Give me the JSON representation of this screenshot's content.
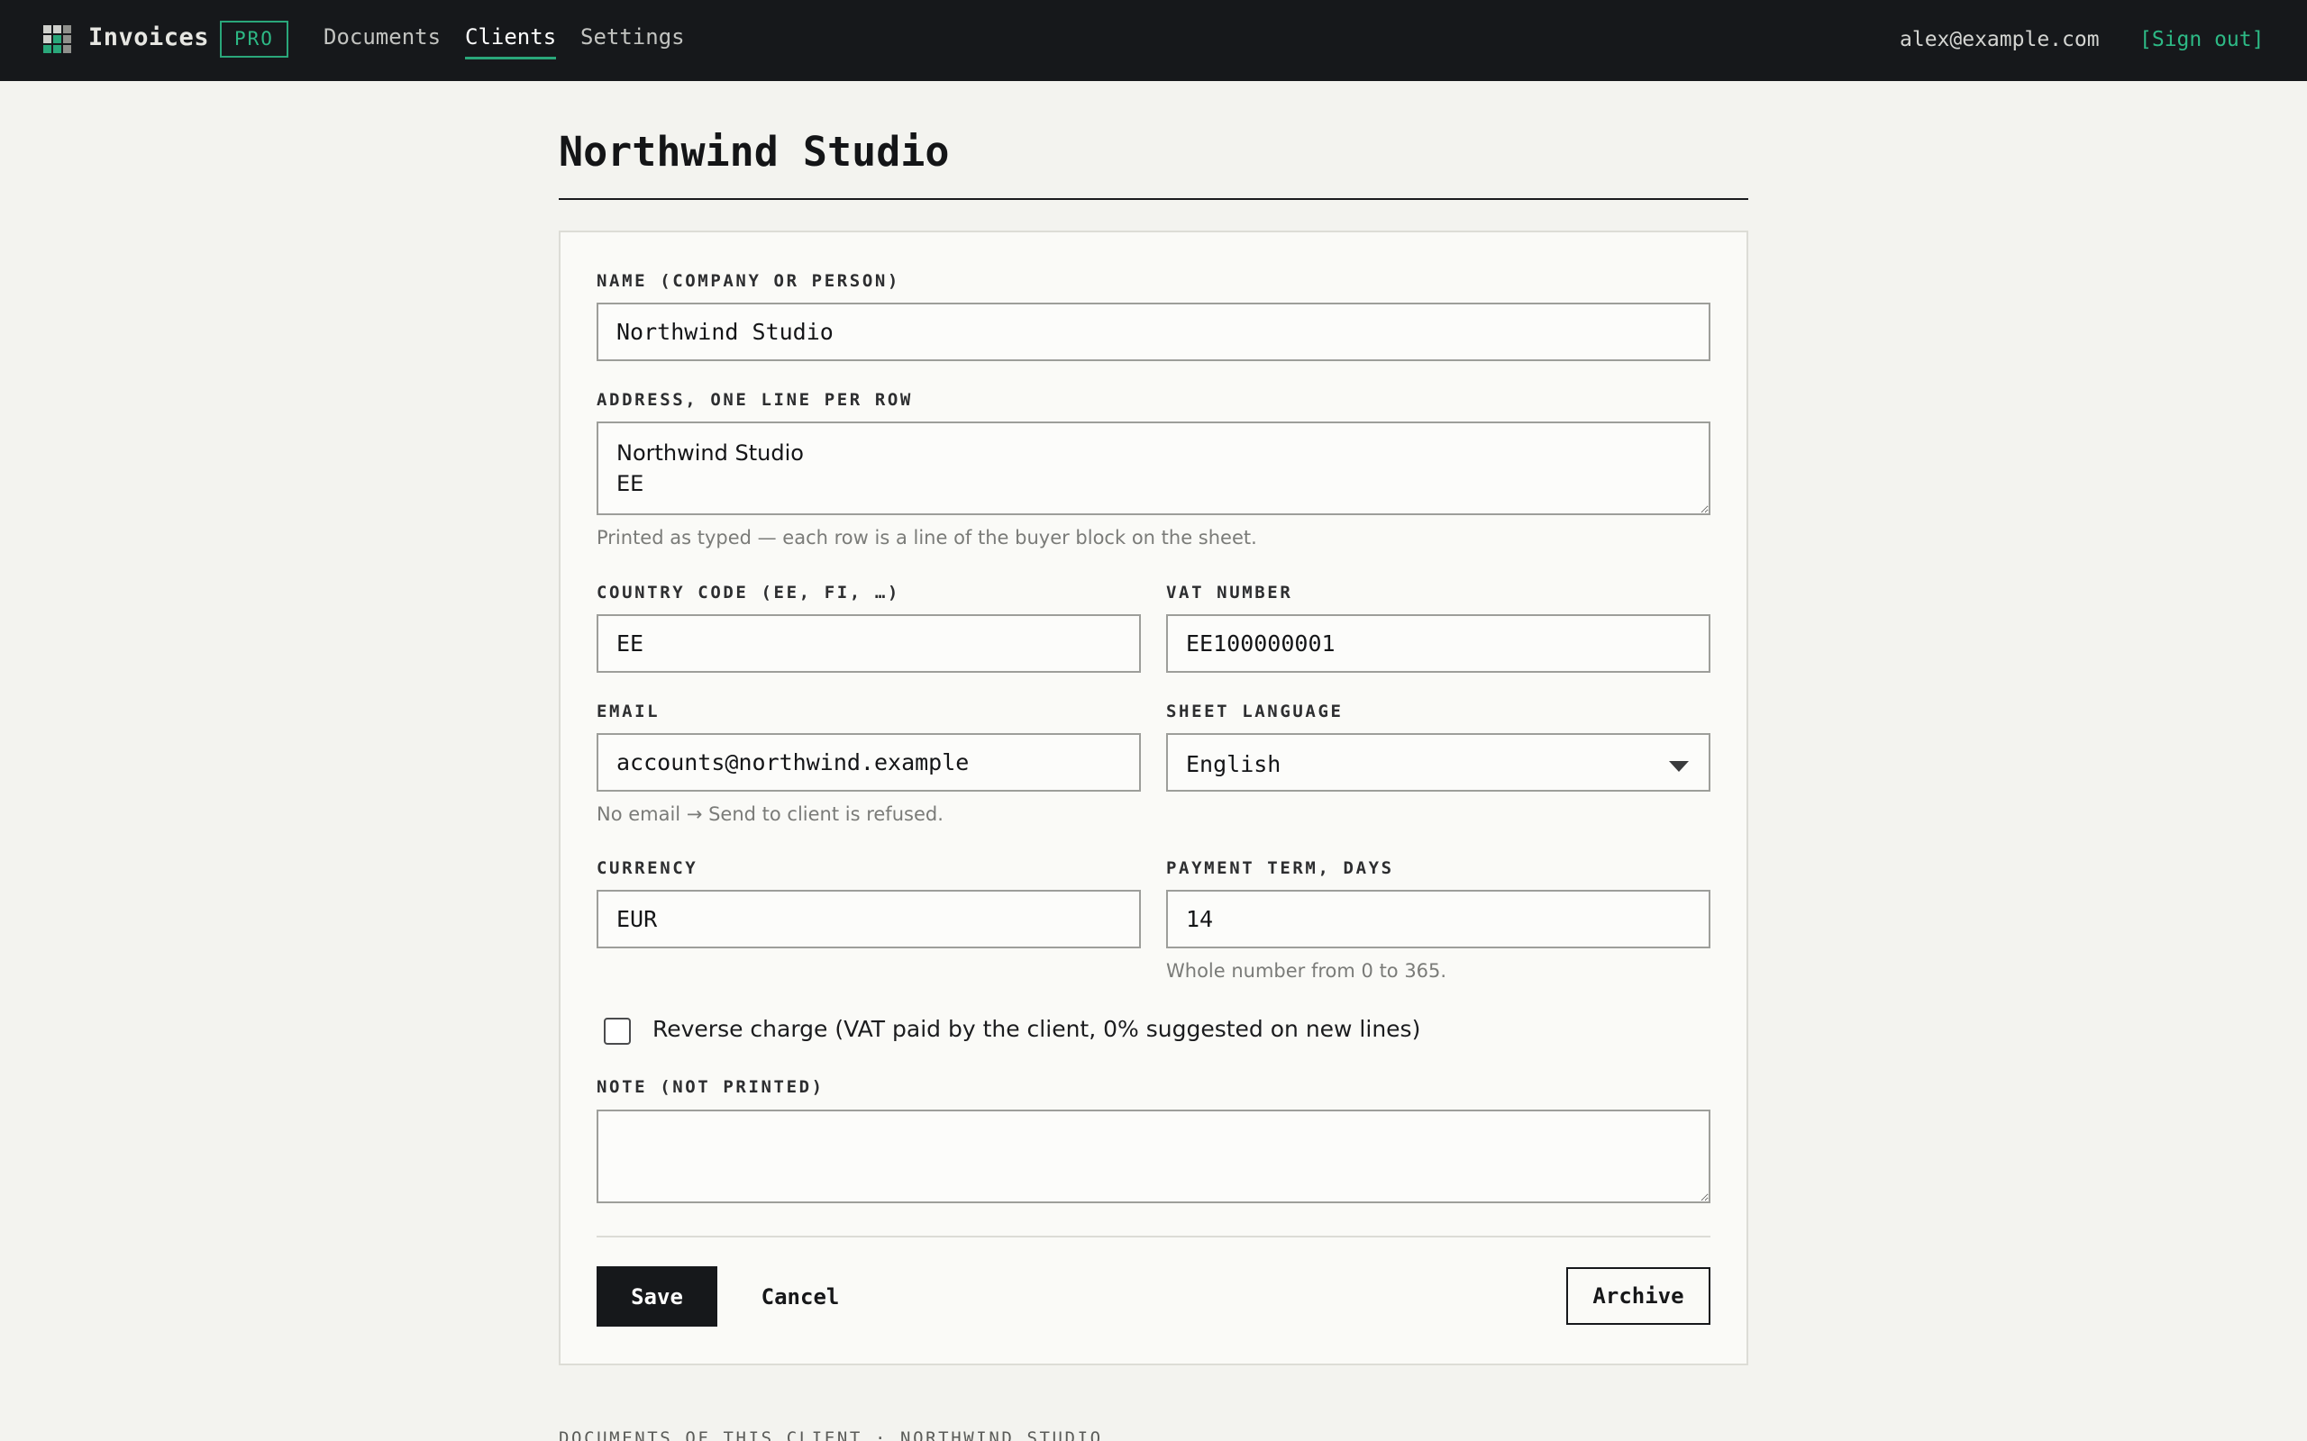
{
  "app": {
    "brand": "Invoices",
    "badge": "PRO",
    "logo_icon": "grid-icon",
    "accent_color": "#2aa77a"
  },
  "nav": {
    "items": [
      {
        "label": "Documents",
        "active": false
      },
      {
        "label": "Clients",
        "active": true
      },
      {
        "label": "Settings",
        "active": false
      }
    ]
  },
  "user": {
    "email": "alex@example.com",
    "sign_out": "[Sign out]"
  },
  "page": {
    "title": "Northwind Studio"
  },
  "form": {
    "name": {
      "label": "NAME (COMPANY OR PERSON)",
      "value": "Northwind Studio"
    },
    "address": {
      "label": "ADDRESS, ONE LINE PER ROW",
      "value": "Northwind Studio\nEE",
      "hint": "Printed as typed — each row is a line of the buyer block on the sheet."
    },
    "country": {
      "label": "COUNTRY CODE (EE, FI, …)",
      "value": "EE"
    },
    "vat": {
      "label": "VAT NUMBER",
      "value": "EE100000001"
    },
    "email": {
      "label": "EMAIL",
      "value": "accounts@northwind.example",
      "hint": "No email → Send to client is refused."
    },
    "language": {
      "label": "SHEET LANGUAGE",
      "value": "English"
    },
    "currency": {
      "label": "CURRENCY",
      "value": "EUR"
    },
    "payment_term": {
      "label": "PAYMENT TERM, DAYS",
      "value": "14",
      "hint": "Whole number from 0 to 365."
    },
    "reverse_charge": {
      "label": "Reverse charge (VAT paid by the client, 0% suggested on new lines)",
      "checked": false
    },
    "note": {
      "label": "NOTE (NOT PRINTED)",
      "value": ""
    },
    "actions": {
      "save": "Save",
      "cancel": "Cancel",
      "archive": "Archive"
    }
  },
  "section_below": {
    "title": "DOCUMENTS OF THIS CLIENT · NORTHWIND STUDIO"
  }
}
